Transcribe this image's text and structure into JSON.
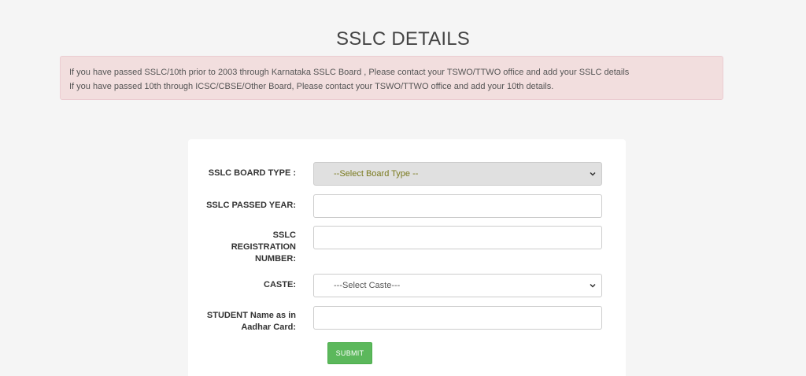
{
  "page": {
    "title": "SSLC DETAILS"
  },
  "alert": {
    "line1": "If you have passed SSLC/10th prior to 2003 through Karnataka SSLC Board , Please contact your TSWO/TTWO office and add your SSLC details",
    "line2": "If you have passed 10th through ICSC/CBSE/Other Board, Please contact your TSWO/TTWO office and add your 10th details."
  },
  "form": {
    "board_type": {
      "label": "SSLC BOARD TYPE :",
      "selected": "--Select Board Type --"
    },
    "passed_year": {
      "label": "SSLC PASSED YEAR:",
      "value": ""
    },
    "registration_number": {
      "label_line1": "SSLC",
      "label_line2": "REGISTRATION",
      "label_line3": "NUMBER:",
      "value": ""
    },
    "caste": {
      "label": "CASTE:",
      "selected": "---Select Caste---"
    },
    "student_name": {
      "label_line1": "STUDENT Name as in",
      "label_line2": "Aadhar Card:",
      "value": ""
    },
    "submit_label": "SUBMIT"
  },
  "colors": {
    "alert_bg": "#f2dede",
    "submit_bg": "#5cb85c",
    "board_select_bg": "#e0e0e0"
  }
}
